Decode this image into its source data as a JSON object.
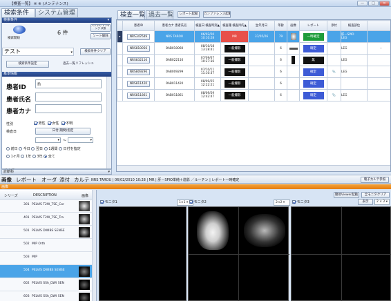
{
  "window": {
    "title": "【検査一覧】 ※ ※ (メンテナンス)",
    "controls": [
      "—",
      "□",
      "✕"
    ]
  },
  "left_tabs": {
    "search_conditions": "検索条件",
    "system_management": "システム管理"
  },
  "left_panel": {
    "header": "検索条件",
    "search_start_label": "検索開始",
    "result_count": "6 件",
    "dock_btn": "パネルの ドッキング 状態",
    "sort_clear_btn": "ソート解除",
    "preset_value": "テスト",
    "condition_clear_btn": "検索条件クリア",
    "set_condition_btn": "検索条件設定",
    "refresh_btn": "過去一覧リフレッシュ",
    "basic_info": "基本情報",
    "patient_id_label": "患者ID",
    "patient_id_value": "n",
    "patient_name_label": "患者氏名",
    "patient_kana_label": "患者カナ",
    "sex_label": "性別",
    "sex_male": "男性",
    "sex_female": "女性",
    "sex_unknown": "不明",
    "exam_date_label": "検査日",
    "date_range_btn": "日付(期間)指定",
    "date_sep": "〜",
    "radios_row1": [
      "前日",
      "今日",
      "翌日",
      "1週間",
      "日付を指定"
    ],
    "radios_row2": [
      "1ヶ月",
      "1年",
      "3年",
      "全て"
    ],
    "exam_type": "検査種",
    "modality": "診断科"
  },
  "top_tabs": {
    "exam_list": "検査一覧",
    "past_list": "過去一覧",
    "report_btn": "レポート起動",
    "conference_btn": "カンファレンス起動"
  },
  "table": {
    "headers": [
      "患者ID",
      "患者カナ 患者氏名",
      "検査日 検査時刻▲",
      "検査種 検査目的▲",
      "生年月日",
      "年齢",
      "画像",
      "レポート",
      "添付",
      "検査部位"
    ],
    "rows": [
      {
        "id": "NRS347649",
        "kana": "",
        "name": "NRS TAROU",
        "date": "06/02/20",
        "time": "10:10:28",
        "mod": "MR",
        "dob": "37/05/26",
        "age": "79",
        "status": "一時確定",
        "site": "肝－SPIO",
        "sub": "LEG"
      },
      {
        "id": "NRS810056",
        "kana": "",
        "name": "OAB010060",
        "date": "08/10/18",
        "time": "13:28:41",
        "mod": "一般撮影",
        "dob": "",
        "age": "6",
        "status": "確定",
        "site": "LEG",
        "sub": ""
      },
      {
        "id": "NRS832116",
        "kana": "",
        "name": "OAB022116",
        "date": "07/09/07",
        "time": "10:27:36",
        "mod": "一般撮影",
        "dob": "",
        "age": "6",
        "status": "無",
        "site": "LEG",
        "sub": ""
      },
      {
        "id": "NRS809296",
        "kana": "",
        "name": "OAB009299",
        "date": "07/10/11",
        "time": "11:10:37",
        "mod": "一般撮影",
        "dob": "",
        "age": "6",
        "status": "確定",
        "site": "LEG",
        "sub": ""
      },
      {
        "id": "NRS811420",
        "kana": "",
        "name": "OAB011420",
        "date": "08/09/25",
        "time": "12:22:21",
        "mod": "一般撮影",
        "dob": "",
        "age": "6",
        "status": "確定",
        "site": "",
        "sub": ""
      },
      {
        "id": "NRS811861",
        "kana": "",
        "name": "OAB011861",
        "date": "08/09/29",
        "time": "12:42:47",
        "mod": "一般撮影",
        "dob": "",
        "age": "6",
        "status": "確定",
        "site": "LEG",
        "sub": ""
      }
    ]
  },
  "bottom_tabs": {
    "image": "画像",
    "report": "レポート",
    "order": "オーダ",
    "attach": "添付",
    "chart": "カルテ",
    "patient_info": "NRS TAROU | 06/02/2010 10:28 | MR | 肝－SPIO単純＋造影 ／ルーチン | レポート一時確定",
    "ekarte_btn": "電子カルテ参照"
  },
  "image_panel": {
    "header": "画像",
    "col_series": "シリーズ",
    "col_desc": "DESCRIPTION",
    "col_img": "画像",
    "series": [
      {
        "no": "301",
        "desc": "PELVIS   T2W_TSE_Cor"
      },
      {
        "no": "401",
        "desc": "PELVIS   T2W_TSE_Tra"
      },
      {
        "no": "501",
        "desc": "PELVIS   DWIBS SENSE"
      },
      {
        "no": "502",
        "desc": "MIP Orth"
      },
      {
        "no": "503",
        "desc": "MIP"
      },
      {
        "no": "504",
        "desc": "PELVIS   DWIBS SENSE"
      },
      {
        "no": "602",
        "desc": "PELVIS   SSh_DWI SEN"
      },
      {
        "no": "603",
        "desc": "PELVIS   SSh_DWI SEN"
      }
    ],
    "viewer_btn": "簡易Viewer起動",
    "clear_btn": "全モニタクリア",
    "display_btn": "表示",
    "monitors": [
      {
        "label": "モニタ1",
        "layout": "1×1"
      },
      {
        "label": "モニタ2",
        "layout": "2×2"
      },
      {
        "label": "モニタ3",
        "layout": "2×2"
      }
    ]
  }
}
